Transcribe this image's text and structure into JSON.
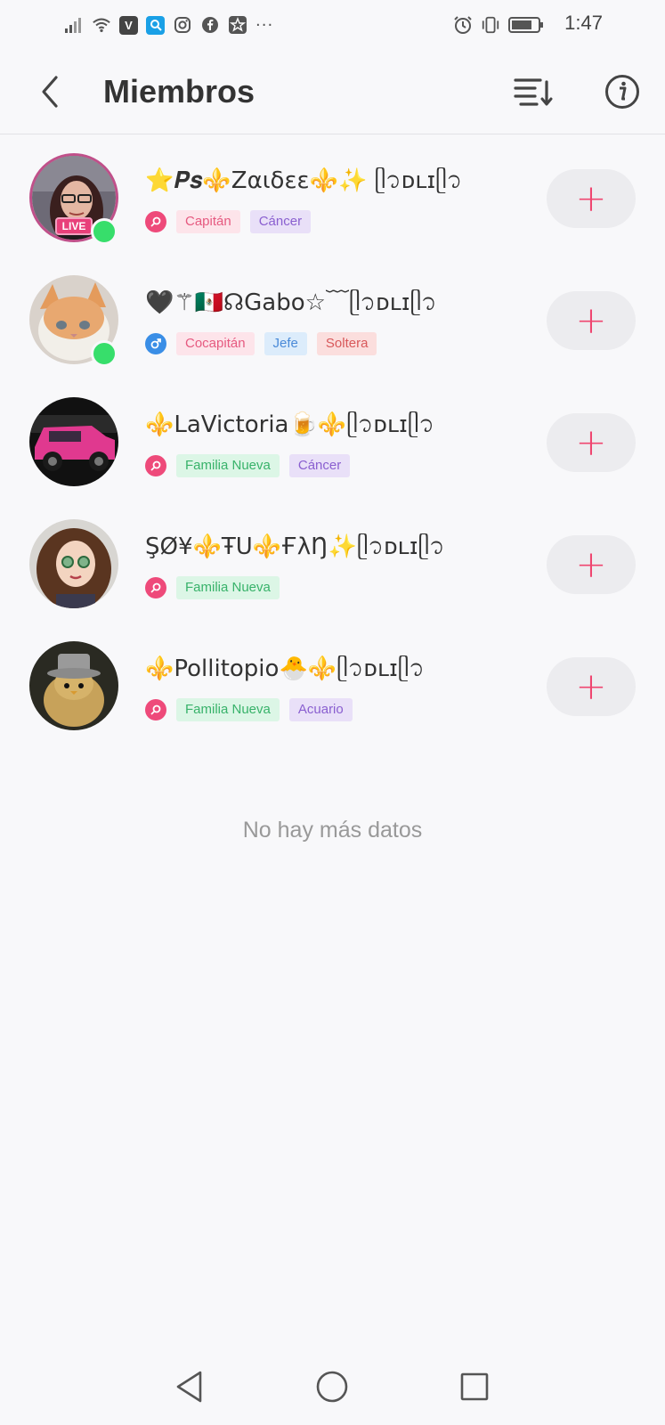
{
  "status_bar": {
    "time": "1:47",
    "left_icons": [
      "signal-icon",
      "wifi-icon",
      "app-v-icon",
      "app-search-icon",
      "instagram-icon",
      "facebook-icon",
      "app-star-icon",
      "more-dots-icon"
    ],
    "app_v_letter": "V",
    "more_dots": "···",
    "right_icons": [
      "alarm-icon",
      "vibrate-icon",
      "battery-icon"
    ]
  },
  "header": {
    "title": "Miembros",
    "back_icon": "chevron-left-icon",
    "sort_icon": "sort-icon",
    "info_icon": "info-icon"
  },
  "members": [
    {
      "name": "⭐️𝑷𝒔⚜️Ζαιδεε⚜️✨ ᥫ᭡ᴅʟɪᥫ᭡",
      "live": true,
      "live_label": "LIVE",
      "online": true,
      "gender": "female",
      "tags": [
        {
          "label": "Capitán",
          "color": "pink"
        },
        {
          "label": "Cáncer",
          "color": "purple"
        }
      ]
    },
    {
      "name": "🖤⚚🇲🇽☊Gabo☆﹋ᥫ᭡ᴅʟɪᥫ᭡",
      "live": false,
      "online": true,
      "gender": "male",
      "tags": [
        {
          "label": "Cocapitán",
          "color": "pink"
        },
        {
          "label": "Jefe",
          "color": "blue"
        },
        {
          "label": "Soltera",
          "color": "red"
        }
      ]
    },
    {
      "name": "⚜️LaVictoria🍺⚜️ᥫ᭡ᴅʟɪᥫ᭡",
      "live": false,
      "online": false,
      "gender": "female",
      "tags": [
        {
          "label": "Familia Nueva",
          "color": "green"
        },
        {
          "label": "Cáncer",
          "color": "purple"
        }
      ]
    },
    {
      "name": "ŞØ¥⚜️ŦU⚜️ҒλŊ✨ᥫ᭡ᴅʟɪᥫ᭡",
      "live": false,
      "online": false,
      "gender": "female",
      "tags": [
        {
          "label": "Familia Nueva",
          "color": "green"
        }
      ]
    },
    {
      "name": "⚜️Pollitopio🐣⚜️ᥫ᭡ᴅʟɪᥫ᭡",
      "live": false,
      "online": false,
      "gender": "female",
      "tags": [
        {
          "label": "Familia Nueva",
          "color": "green"
        },
        {
          "label": "Acuario",
          "color": "purple"
        }
      ]
    }
  ],
  "add_label": "+",
  "footer_text": "No hay más datos",
  "nav": {
    "back_icon": "triangle-back-icon",
    "home_icon": "circle-home-icon",
    "recents_icon": "square-recents-icon"
  },
  "colors": {
    "accent": "#ef4670",
    "online": "#37de6b",
    "female": "#ee4a7a",
    "male": "#3a8ee6"
  }
}
